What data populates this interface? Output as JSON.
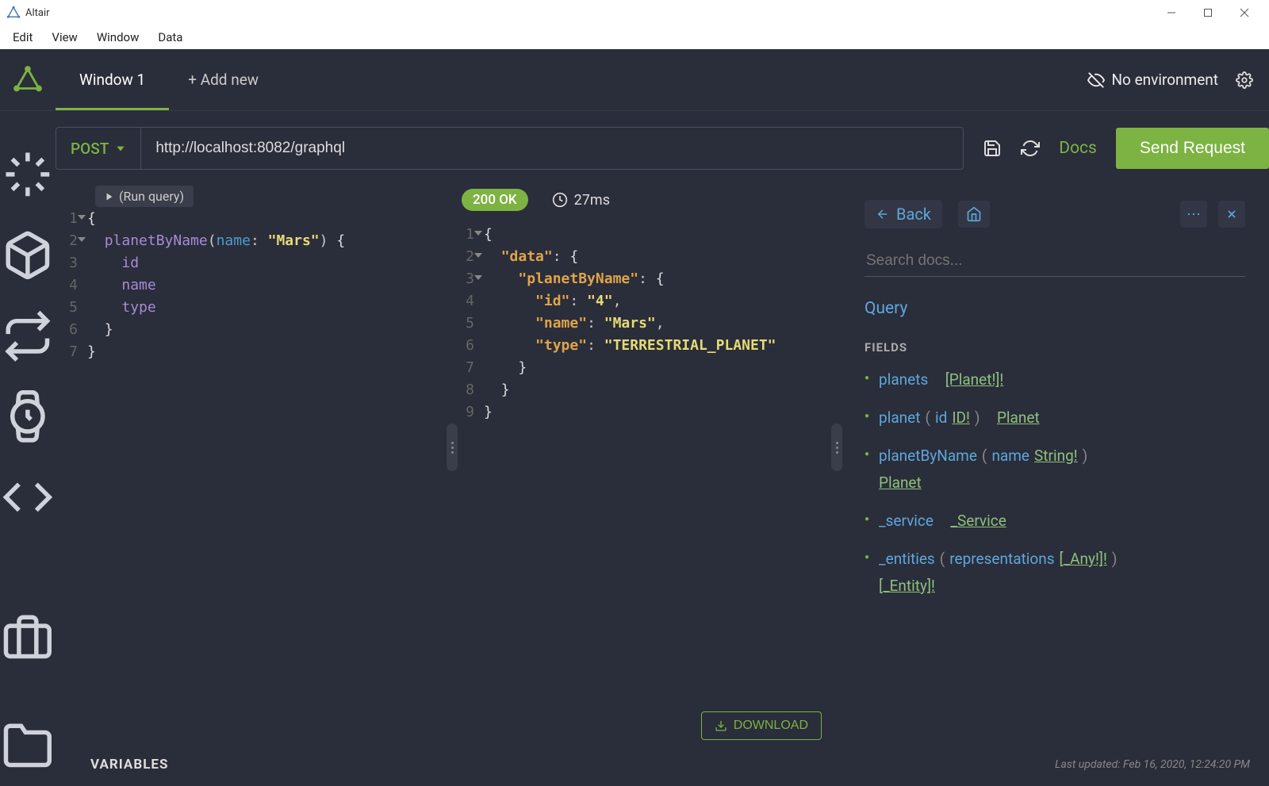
{
  "app": {
    "title": "Altair"
  },
  "menubar": [
    "Edit",
    "View",
    "Window",
    "Data"
  ],
  "tabs": {
    "active": "Window 1",
    "add_label": "+ Add new"
  },
  "environment": {
    "label": "No environment"
  },
  "request": {
    "method": "POST",
    "url": "http://localhost:8082/graphql",
    "docs_link": "Docs",
    "send_label": "Send Request"
  },
  "query": {
    "run_hint": "(Run query)",
    "lines": [
      {
        "n": 1,
        "fold": true,
        "html": "<span class='tok-brace'>{</span>"
      },
      {
        "n": 2,
        "fold": true,
        "html": "  <span class='tok-fn'>planetByName</span><span class='tok-paren'>(</span><span class='tok-arg'>name</span><span class='tok-colon'>: </span><span class='tok-str'>\"Mars\"</span><span class='tok-paren'>)</span> <span class='tok-brace'>{</span>"
      },
      {
        "n": 3,
        "html": "    <span class='tok-fn'>id</span>"
      },
      {
        "n": 4,
        "html": "    <span class='tok-fn'>name</span>"
      },
      {
        "n": 5,
        "html": "    <span class='tok-fn'>type</span>"
      },
      {
        "n": 6,
        "html": "  <span class='tok-brace'>}</span>"
      },
      {
        "n": 7,
        "html": "<span class='tok-brace'>}</span>"
      }
    ]
  },
  "response": {
    "status": "200 OK",
    "time": "27ms",
    "download_label": "DOWNLOAD",
    "lines": [
      {
        "n": 1,
        "fold": true,
        "html": "<span class='tok-brace'>{</span>"
      },
      {
        "n": 2,
        "fold": true,
        "html": "  <span class='tok-key'>\"data\"</span><span class='tok-colon'>: </span><span class='tok-brace'>{</span>"
      },
      {
        "n": 3,
        "fold": true,
        "html": "    <span class='tok-key'>\"planetByName\"</span><span class='tok-colon'>: </span><span class='tok-brace'>{</span>"
      },
      {
        "n": 4,
        "html": "      <span class='tok-key'>\"id\"</span><span class='tok-colon'>: </span><span class='tok-str'>\"4\"</span><span class='tok-colon'>,</span>"
      },
      {
        "n": 5,
        "html": "      <span class='tok-key'>\"name\"</span><span class='tok-colon'>: </span><span class='tok-str'>\"Mars\"</span><span class='tok-colon'>,</span>"
      },
      {
        "n": 6,
        "html": "      <span class='tok-key'>\"type\"</span><span class='tok-colon'>: </span><span class='tok-str'>\"TERRESTRIAL_PLANET\"</span>"
      },
      {
        "n": 7,
        "html": "    <span class='tok-brace'>}</span>"
      },
      {
        "n": 8,
        "html": "  <span class='tok-brace'>}</span>"
      },
      {
        "n": 9,
        "html": "<span class='tok-brace'>}</span>"
      }
    ]
  },
  "docs": {
    "back_label": "Back",
    "search_placeholder": "Search docs...",
    "root_type": "Query",
    "fields_header": "FIELDS",
    "fields": [
      {
        "name": "planets",
        "args": [],
        "return": "[Planet!]!"
      },
      {
        "name": "planet",
        "args": [
          {
            "name": "id",
            "type": "ID!"
          }
        ],
        "return": "Planet"
      },
      {
        "name": "planetByName",
        "args": [
          {
            "name": "name",
            "type": "String!"
          }
        ],
        "return": "Planet",
        "wrap": true
      },
      {
        "name": "_service",
        "args": [],
        "return": "_Service"
      },
      {
        "name": "_entities",
        "args": [
          {
            "name": "representations",
            "type": "[_Any!]!"
          }
        ],
        "return": "[_Entity]!",
        "wrap": true
      }
    ]
  },
  "bottom": {
    "variables_label": "VARIABLES",
    "last_updated": "Last updated: Feb 16, 2020, 12:24:20 PM"
  }
}
